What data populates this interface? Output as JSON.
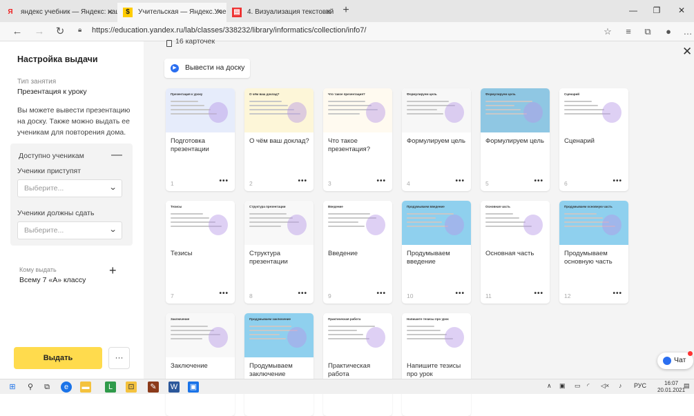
{
  "browser": {
    "tabs": [
      {
        "icon": "Я",
        "title": "яндекс учебник — Яндекс: нашл"
      },
      {
        "icon": "$",
        "title": "Учительская — Яндекс.Учебник"
      },
      {
        "icon": "▤",
        "title": "4. Визуализация текстовой инф"
      }
    ],
    "new_tab": "+",
    "url": "https://education.yandex.ru/lab/classes/338232/library/informatics/collection/info7/"
  },
  "sidebar": {
    "title": "Настройка выдачи",
    "lesson_type_label": "Тип занятия",
    "lesson_type_value": "Презентация к уроку",
    "description": "Вы можете вывести презентацию на доску. Также можно выдать ее ученикам для повторения дома.",
    "available_label": "Доступно ученикам",
    "start_label": "Ученики приступят",
    "start_placeholder": "Выберите...",
    "due_label": "Ученики должны сдать",
    "due_placeholder": "Выберите...",
    "whom_label": "Кому выдать",
    "whom_value": "Всему 7 «А» классу",
    "issue_button": "Выдать",
    "more_button": "···"
  },
  "main": {
    "count": "16 карточек",
    "board_button": "Вывести на доску",
    "cards": [
      {
        "caption": "Подготовка презентации",
        "num": "1",
        "thumb": "Презентация к уроку"
      },
      {
        "caption": "О чём ваш доклад?",
        "num": "2",
        "thumb": "О чём ваш доклад?"
      },
      {
        "caption": "Что такое презентация?",
        "num": "3",
        "thumb": "Что такое презентация?"
      },
      {
        "caption": "Формулируем цель",
        "num": "4",
        "thumb": "Формулируем цель"
      },
      {
        "caption": "Формулируем цель",
        "num": "5",
        "thumb": "Формулируем цель"
      },
      {
        "caption": "Сценарий",
        "num": "6",
        "thumb": "Сценарий"
      },
      {
        "caption": "Тезисы",
        "num": "7",
        "thumb": "Тезисы"
      },
      {
        "caption": "Структура презентации",
        "num": "8",
        "thumb": "Структура презентации"
      },
      {
        "caption": "Введение",
        "num": "9",
        "thumb": "Введение"
      },
      {
        "caption": "Продумываем введение",
        "num": "10",
        "thumb": "Продумываем введение"
      },
      {
        "caption": "Основная часть",
        "num": "11",
        "thumb": "Основная часть"
      },
      {
        "caption": "Продумываем основную часть",
        "num": "12",
        "thumb": "Продумываем основную часть"
      },
      {
        "caption": "Заключение",
        "num": "",
        "thumb": "Заключение"
      },
      {
        "caption": "Продумываем заключение",
        "num": "",
        "thumb": "Продумываем заключение"
      },
      {
        "caption": "Практическая работа",
        "num": "",
        "thumb": "Практическая работа"
      },
      {
        "caption": "Напишите тезисы про урок",
        "num": "",
        "thumb": "Напишите тезисы про урок"
      }
    ],
    "card_menu": "•••"
  },
  "chat": {
    "label": "Чат"
  },
  "taskbar": {
    "lang": "РУС",
    "time": "16:07",
    "date": "20.01.2021"
  },
  "colors": {
    "accent": "#ffdb4d",
    "link": "#2a6ef0"
  }
}
